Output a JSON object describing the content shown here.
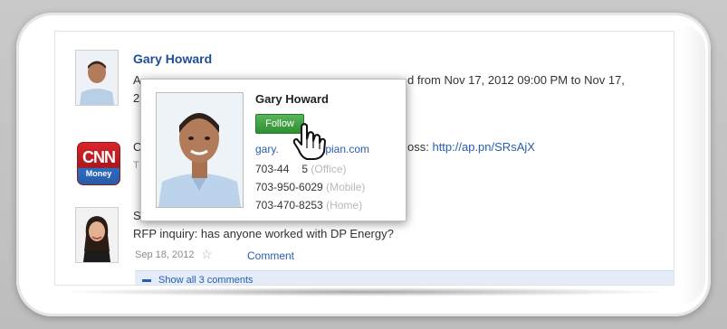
{
  "feed": {
    "post1": {
      "author": "Gary Howard",
      "line1_lead": "A",
      "line1_tail": "d from Nov 17, 2012 09:00 PM to Nov 17,",
      "line2_lead": "2"
    },
    "post2": {
      "line_lead": "C",
      "line_mid": "oss: ",
      "link": "http://ap.pn/SRsAjX",
      "meta_lead": "T"
    },
    "post3": {
      "line_lead": "S",
      "text": "RFP inquiry: has anyone worked with DP Energy?",
      "date": "Sep 18, 2012",
      "comment_label": "Comment",
      "show_comments": "Show all 3 comments"
    },
    "cnn_logo": {
      "top": "CNN",
      "bottom": "Money"
    }
  },
  "popup": {
    "name": "Gary Howard",
    "follow_label": "Follow",
    "email_prefix": "gary.",
    "email_suffix": "@appian.com",
    "phones": [
      {
        "number": "703-44",
        "hidden": "",
        "tail": "5",
        "kind": "(Office)"
      },
      {
        "number": "703-950-6029",
        "kind": "(Mobile)"
      },
      {
        "number": "703-470-8253",
        "kind": "(Home)"
      }
    ]
  },
  "colors": {
    "link": "#2a5db0",
    "follow_green": "#3aa53e",
    "name_blue": "#1f4e96"
  },
  "icons": [
    "star-icon",
    "comment-bubble-icon",
    "hand-pointer-icon"
  ]
}
